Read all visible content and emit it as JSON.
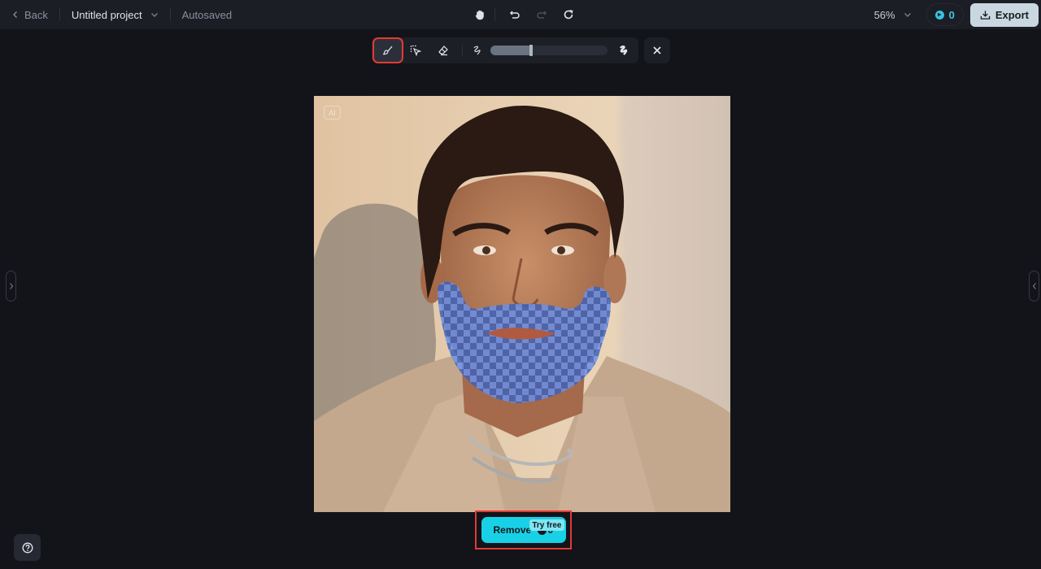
{
  "topbar": {
    "back_label": "Back",
    "project_title": "Untitled project",
    "save_status": "Autosaved",
    "zoom_level": "56%",
    "credits": "0",
    "export_label": "Export",
    "center_icons": [
      "hand-icon",
      "undo-icon",
      "redo-icon",
      "refresh-icon"
    ]
  },
  "toolbar": {
    "tools": [
      {
        "name": "brush",
        "icon": "brush-icon",
        "active": true
      },
      {
        "name": "select",
        "icon": "select-area-icon",
        "active": false
      },
      {
        "name": "eraser",
        "icon": "eraser-icon",
        "active": false
      }
    ],
    "brush_size_fraction": 0.35,
    "min_icon": "brush-size-small-icon",
    "max_icon": "brush-size-large-icon"
  },
  "canvas": {
    "badge": "AI",
    "mask_color": "#4a78e0"
  },
  "remove_button": {
    "label": "Remove",
    "cost": "0",
    "badge": "Try free"
  },
  "colors": {
    "background": "#131419",
    "topbar": "#1c1e26",
    "accent": "#19d1e6",
    "highlight": "#e53935"
  }
}
